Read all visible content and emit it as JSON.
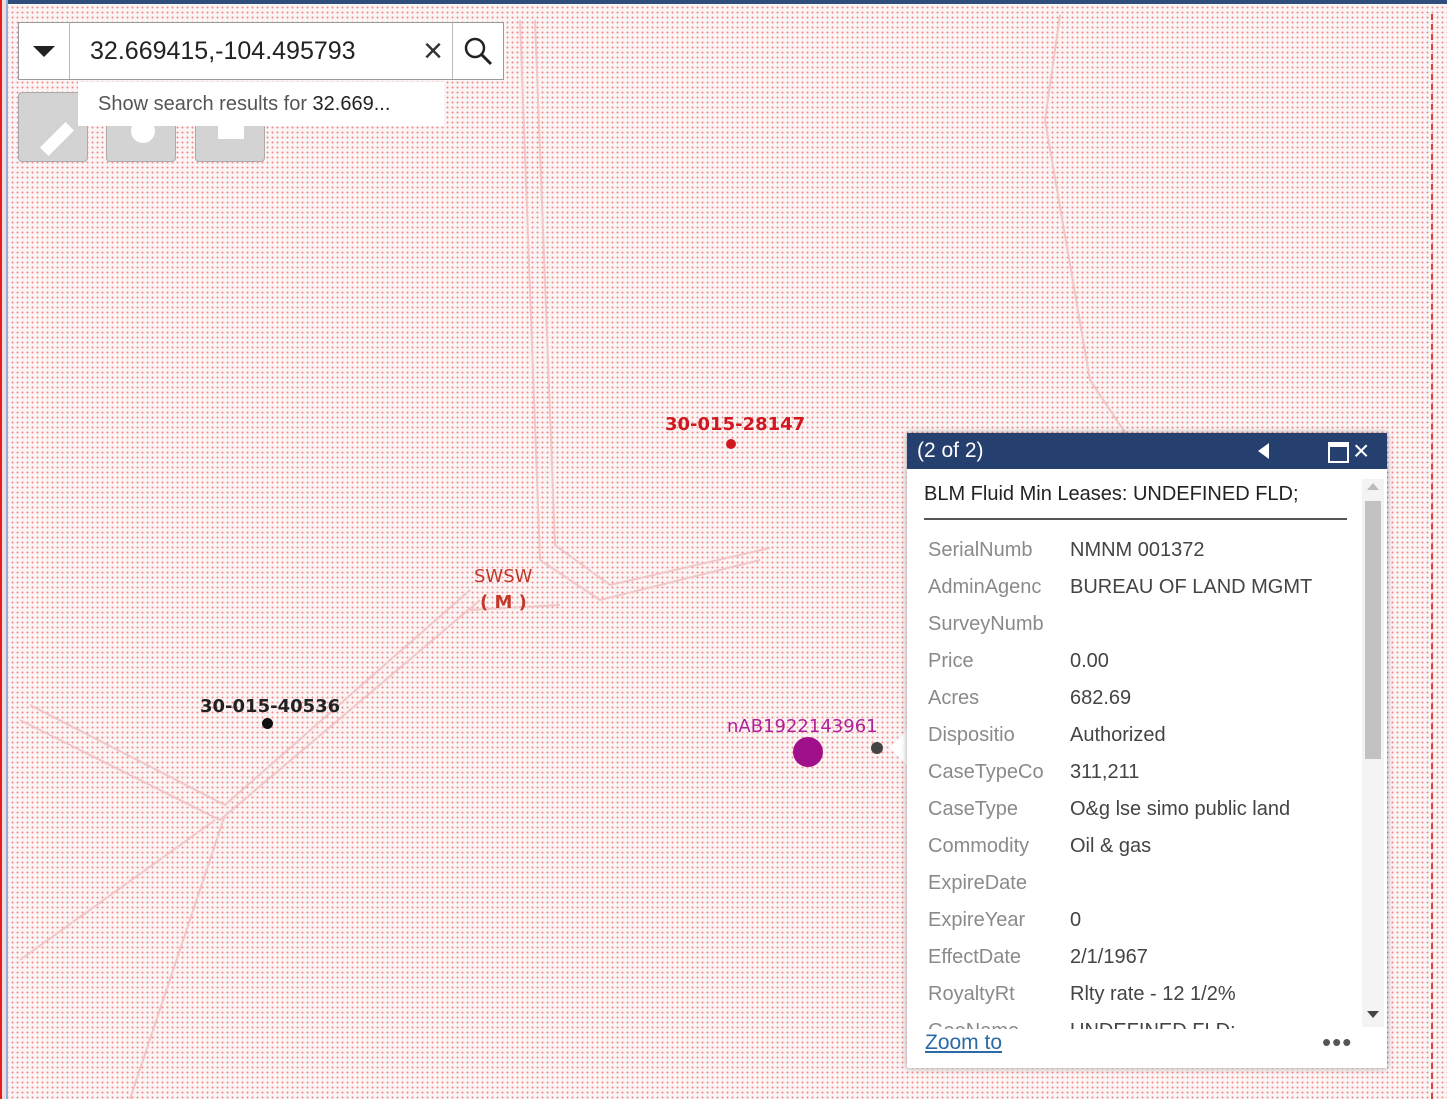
{
  "search": {
    "value": "32.669415,-104.495793",
    "suggestion_prefix": "Show search results for ",
    "suggestion_query": "32.669..."
  },
  "tools": [
    "measure-icon",
    "layers-icon",
    "print-icon"
  ],
  "map_labels": {
    "well_1": "30-015-28147",
    "well_2": "30-015-40536",
    "swsw": "SWSW",
    "swsw_sub": "( M )",
    "nab": "nAB1922143961"
  },
  "colors": {
    "map_dot": "#f08c8c",
    "popup_header": "#253f6e",
    "well_red": "#d01820",
    "nab_purple": "#a0108a",
    "quarter_label": "#c0392b"
  },
  "popup": {
    "header": "(2 of 2)",
    "title": "BLM Fluid Min Leases: UNDEFINED FLD;",
    "rows": [
      {
        "k": "SerialNumb",
        "v": "NMNM 001372"
      },
      {
        "k": "AdminAgenc",
        "v": "BUREAU OF LAND MGMT"
      },
      {
        "k": "SurveyNumb",
        "v": ""
      },
      {
        "k": "Price",
        "v": "0.00"
      },
      {
        "k": "Acres",
        "v": "682.69"
      },
      {
        "k": "Dispositio",
        "v": "Authorized"
      },
      {
        "k": "CaseTypeCo",
        "v": "311,211"
      },
      {
        "k": "CaseType",
        "v": "O&g lse simo public land"
      },
      {
        "k": "Commodity",
        "v": "Oil & gas"
      },
      {
        "k": "ExpireDate",
        "v": ""
      },
      {
        "k": "ExpireYear",
        "v": "0"
      },
      {
        "k": "EffectDate",
        "v": "2/1/1967"
      },
      {
        "k": "RoyaltyRt",
        "v": "Rlty rate - 12 1/2%"
      },
      {
        "k": "GeoName",
        "v": "UNDEFINED FLD;"
      }
    ],
    "zoom_label": "Zoom to",
    "more_label": "•••"
  }
}
